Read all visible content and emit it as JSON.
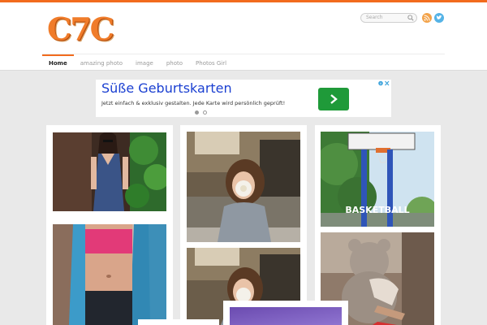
{
  "site": {
    "logo_text": "C7C"
  },
  "search": {
    "placeholder": "Search"
  },
  "social": [
    {
      "icon": "rss-icon",
      "color": "#f3a34a"
    },
    {
      "icon": "twitter-icon",
      "color": "#55b3e6"
    }
  ],
  "nav": {
    "items": [
      {
        "label": "Home",
        "active": true
      },
      {
        "label": "amazing photo",
        "active": false
      },
      {
        "label": "image",
        "active": false
      },
      {
        "label": "photo",
        "active": false
      },
      {
        "label": "Photos Girl",
        "active": false
      }
    ]
  },
  "ad": {
    "title": "Süße Geburtskarten",
    "text": "Jetzt einfach & exklusiv gestalten. Jede Karte wird persönlich geprüft!",
    "accent": "#1f9a39"
  },
  "gallery": {
    "tiles": [
      {
        "icon": "photo-girl-blue-dress"
      },
      {
        "icon": "photo-fitness-woman"
      },
      {
        "icon": "photo-child-flower"
      },
      {
        "icon": "photo-child-flower-repeat"
      },
      {
        "icon": "photo-basketball",
        "caption": "BASKETBALL"
      },
      {
        "icon": "photo-teddy-bear"
      },
      {
        "icon": "photo-purple"
      }
    ]
  },
  "colors": {
    "accent": "#f26b1d",
    "link": "#1a3fd1"
  }
}
